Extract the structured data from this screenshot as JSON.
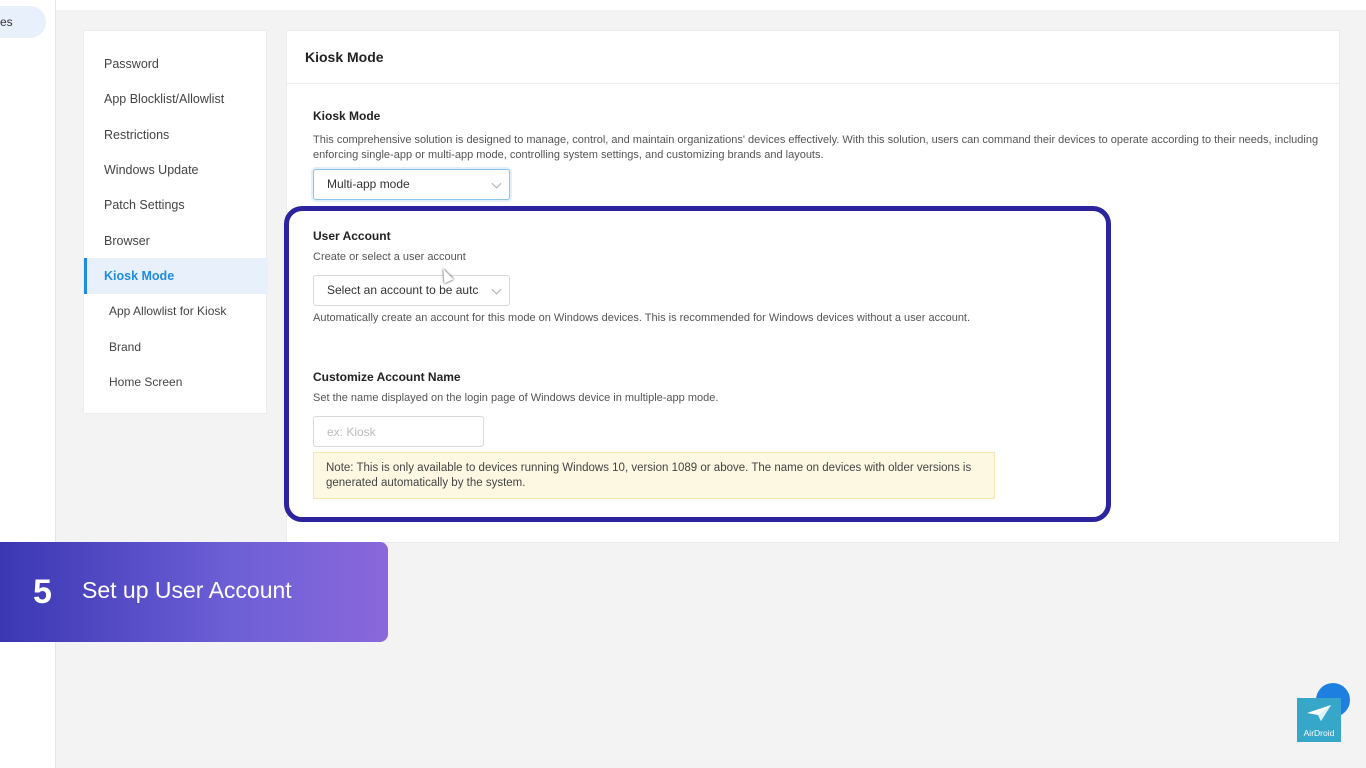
{
  "app_nav": {
    "partial_label": "es"
  },
  "submenu": {
    "items": [
      {
        "label": "Password"
      },
      {
        "label": "App Blocklist/Allowlist"
      },
      {
        "label": "Restrictions"
      },
      {
        "label": "Windows Update"
      },
      {
        "label": "Patch Settings"
      },
      {
        "label": "Browser"
      },
      {
        "label": "Kiosk Mode",
        "active": true
      },
      {
        "label": "App Allowlist for Kiosk"
      },
      {
        "label": "Brand"
      },
      {
        "label": "Home Screen"
      }
    ]
  },
  "panel": {
    "header_title": "Kiosk Mode",
    "kiosk_mode": {
      "title": "Kiosk Mode",
      "description": "This comprehensive solution is designed to manage, control, and maintain organizations' devices effectively. With this solution, users can command their devices to operate according to their needs, including enforcing single-app or multi-app mode, controlling system settings, and customizing brands and layouts.",
      "selected_mode": "Multi-app mode"
    },
    "user_account": {
      "title": "User Account",
      "subtitle": "Create or select a user account",
      "select_value": "Select an account to be autc",
      "help": "Automatically create an account for this mode on Windows devices. This is recommended for Windows devices without a user account."
    },
    "account_name": {
      "title": "Customize Account Name",
      "subtitle": "Set the name displayed on the login page of Windows device in multiple-app mode.",
      "placeholder": "ex: Kiosk",
      "note": "Note: This is only available to devices running Windows 10, version 1089 or above. The name on devices with older versions is generated automatically by the system."
    }
  },
  "banner": {
    "step": "5",
    "text": "Set up User Account"
  },
  "logo": {
    "label": "AirDroid"
  },
  "colors": {
    "accent": "#1f8ce0",
    "highlight_border": "#2c239e",
    "banner_start": "#3b37b3",
    "banner_end": "#8a68db",
    "note_bg": "#fdf8e2"
  }
}
